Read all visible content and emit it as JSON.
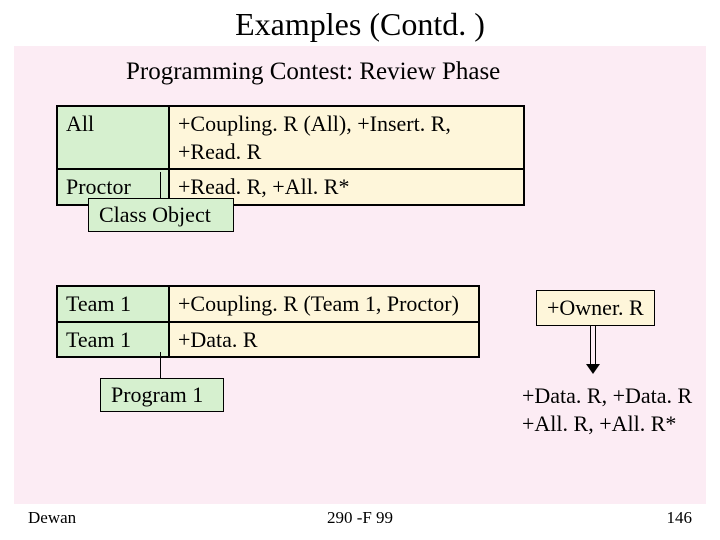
{
  "title": "Examples (Contd. )",
  "subtitle": "Programming Contest: Review Phase",
  "table1": {
    "r1c1": "All",
    "r1c2": "+Coupling. R (All), +Insert. R, +Read. R",
    "r2c1": "Proctor",
    "r2c2": "+Read. R, +All. R*"
  },
  "tag1": "Class Object",
  "table2": {
    "r1c1": "Team 1",
    "r1c2": "+Coupling. R (Team 1, Proctor)",
    "r2c1": "Team 1",
    "r2c2": "+Data. R"
  },
  "owner": "+Owner. R",
  "tag2": "Program 1",
  "annot": {
    "line1": "+Data. R, +Data. R",
    "line2": "+All. R, +All. R*"
  },
  "footer": {
    "left": "Dewan",
    "mid": "290 -F 99",
    "right": "146"
  }
}
